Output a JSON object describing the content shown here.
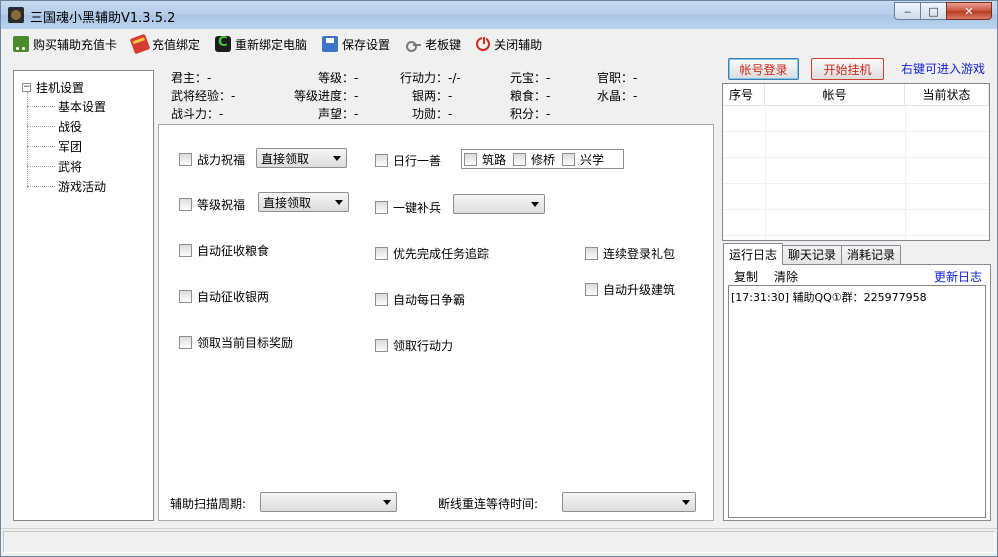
{
  "window": {
    "title": "三国魂小黑辅助V1.3.5.2",
    "minimize": "‒",
    "maximize": "□",
    "close": "✕"
  },
  "toolbar": [
    {
      "label": "购买辅助充值卡",
      "icon": "cart-icon"
    },
    {
      "label": "充值绑定",
      "icon": "gift-icon"
    },
    {
      "label": "重新绑定电脑",
      "icon": "rebind-icon"
    },
    {
      "label": "保存设置",
      "icon": "save-icon"
    },
    {
      "label": "老板键",
      "icon": "key-icon"
    },
    {
      "label": "关闭辅助",
      "icon": "power-icon"
    }
  ],
  "tree": {
    "root": "挂机设置",
    "toggle": "−",
    "children": [
      "基本设置",
      "战役",
      "军团",
      "武将",
      "游戏活动"
    ]
  },
  "info": {
    "row1": [
      "君主：-",
      "等级：-",
      "行动力：-/-",
      "元宝：-",
      "官职：-"
    ],
    "row2": [
      "武将经验：-",
      "等级进度：-",
      "银两：-",
      "粮食：-",
      "水晶：-"
    ],
    "row3": [
      "战斗力：-",
      "声望：-",
      "功勋：-",
      "积分：-"
    ]
  },
  "options": {
    "battle_bless": "战力祝福",
    "battle_bless_mode": "直接领取",
    "level_bless": "等级祝福",
    "level_bless_mode": "直接领取",
    "auto_grain": "自动征收粮食",
    "auto_silver": "自动征收银两",
    "target_reward": "领取当前目标奖励",
    "daily_good": "日行一善",
    "build_road": "筑路",
    "repair_bridge": "修桥",
    "promote_study": "兴学",
    "one_key_refill": "一键补兵",
    "one_key_refill_mode": "",
    "task_tracking": "优先完成任务追踪",
    "daily_contest": "自动每日争霸",
    "claim_action": "领取行动力",
    "login_gift": "连续登录礼包",
    "auto_upgrade": "自动升级建筑",
    "scan_period_label": "辅助扫描周期:",
    "scan_period_value": "",
    "reconnect_label": "断线重连等待时间:",
    "reconnect_value": ""
  },
  "right": {
    "login_button": "帐号登录",
    "start_button": "开始挂机",
    "hint": "右键可进入游戏",
    "table_headers": [
      "序号",
      "帐号",
      "当前状态"
    ],
    "tabs": [
      "运行日志",
      "聊天记录",
      "消耗记录"
    ],
    "copy": "复制",
    "clear": "清除",
    "refresh": "更新日志",
    "log_lines": [
      "[17:31:30] 辅助QQ①群：225977958"
    ]
  },
  "colors": {
    "accent_red": "#d0281a",
    "link_blue": "#1224d6",
    "window_bg": "#f0f0f0"
  }
}
